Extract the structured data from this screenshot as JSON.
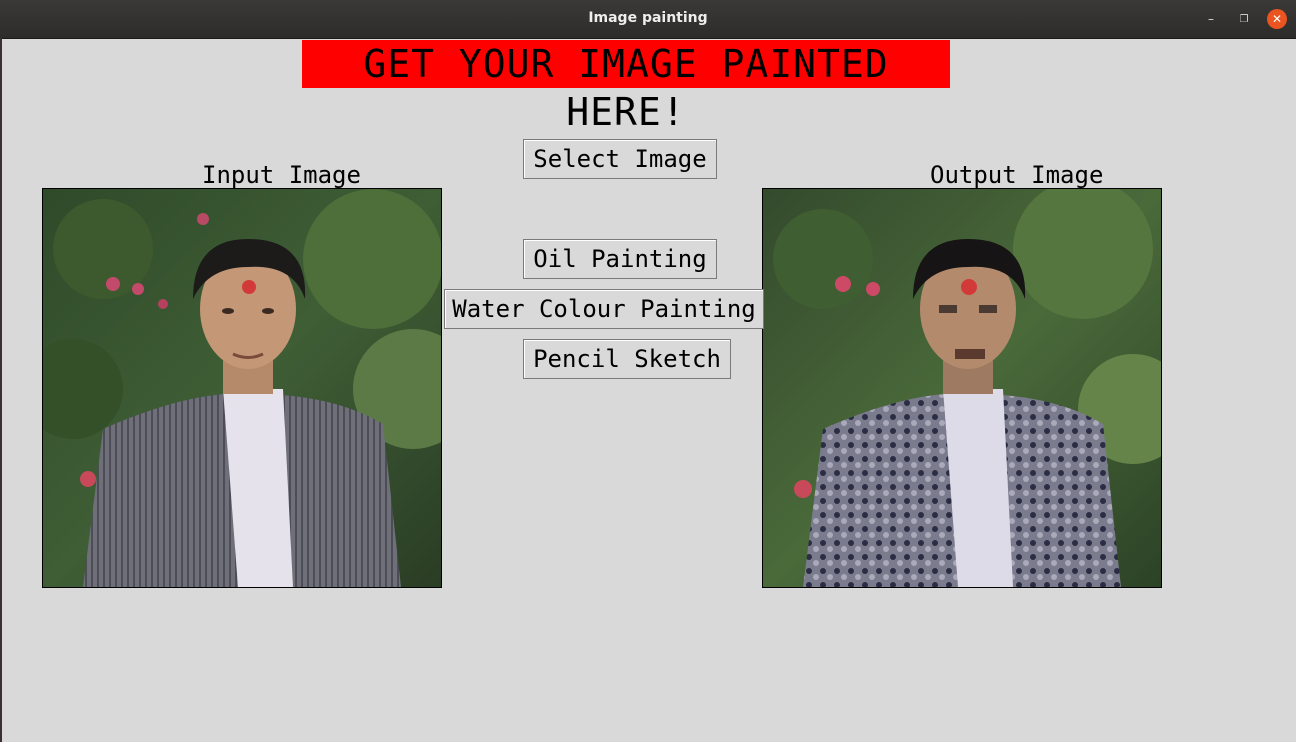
{
  "window": {
    "title": "Image painting",
    "controls": {
      "minimize": "–",
      "maximize": "❐",
      "close": "✕"
    }
  },
  "banner": {
    "text": "GET YOUR IMAGE PAINTED HERE!",
    "background": "#ff0000"
  },
  "input_panel": {
    "label": "Input Image"
  },
  "output_panel": {
    "label": "Output Image"
  },
  "buttons": {
    "select": "Select Image",
    "oil": "Oil Painting",
    "water": "Water Colour Painting",
    "pencil": "Pencil Sketch"
  },
  "colors": {
    "close_button": "#e95420",
    "window_background": "#d9d9d9"
  }
}
